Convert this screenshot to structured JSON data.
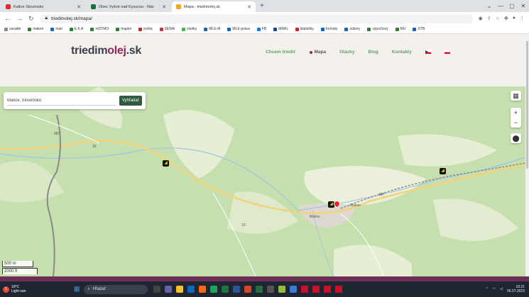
{
  "browser": {
    "tabs": [
      {
        "title": "Kalkor Slovensko",
        "favicon_color": "#d93025",
        "active": false
      },
      {
        "title": "Obec Vyšné nad Kysucou - Náv",
        "favicon_color": "#1f6b3a",
        "active": false
      },
      {
        "title": "Mapa - triedimolej.sk",
        "favicon_color": "#f5a623",
        "active": true
      }
    ],
    "new_tab": "+",
    "url": "triedimolej.sk/mapa/",
    "bookmarks": [
      "zaradie",
      "makeo",
      "mail",
      "E.K.A",
      "mDTMO",
      "mapko",
      "pošta",
      "SEWA",
      "všetky",
      "MLE-M",
      "MLE-práva",
      "FB",
      "MIMU",
      "štatistiky",
      "formáty",
      "súbory",
      "výpočtový",
      "MU",
      "STB"
    ]
  },
  "site": {
    "logo_main": "triedim",
    "logo_accent": "olej",
    "logo_tld": ".sk",
    "menu": [
      {
        "label": "Chcem triediť",
        "active": false
      },
      {
        "label": "Mapa",
        "active": true
      },
      {
        "label": "Otázky",
        "active": false
      },
      {
        "label": "Blog",
        "active": false
      },
      {
        "label": "Kontakty",
        "active": false
      }
    ],
    "languages": [
      "cs-flag-icon",
      "pl-flag-icon"
    ]
  },
  "map": {
    "search_value": "Makov, Slovensko",
    "search_button": "Vyhľadať",
    "zoom_in": "+",
    "zoom_out": "−",
    "scale_metric": "500 m",
    "scale_imperial": "2000 ft",
    "place_labels": [
      "Makov",
      "Makov",
      "487",
      "16",
      "10",
      "487",
      "Makov"
    ]
  },
  "taskbar": {
    "weather_temp": "19°C",
    "weather_desc": "Light rain",
    "weather_badge": "1",
    "search_placeholder": "Hľadať",
    "time": "10:31",
    "date": "06.07.2023"
  }
}
